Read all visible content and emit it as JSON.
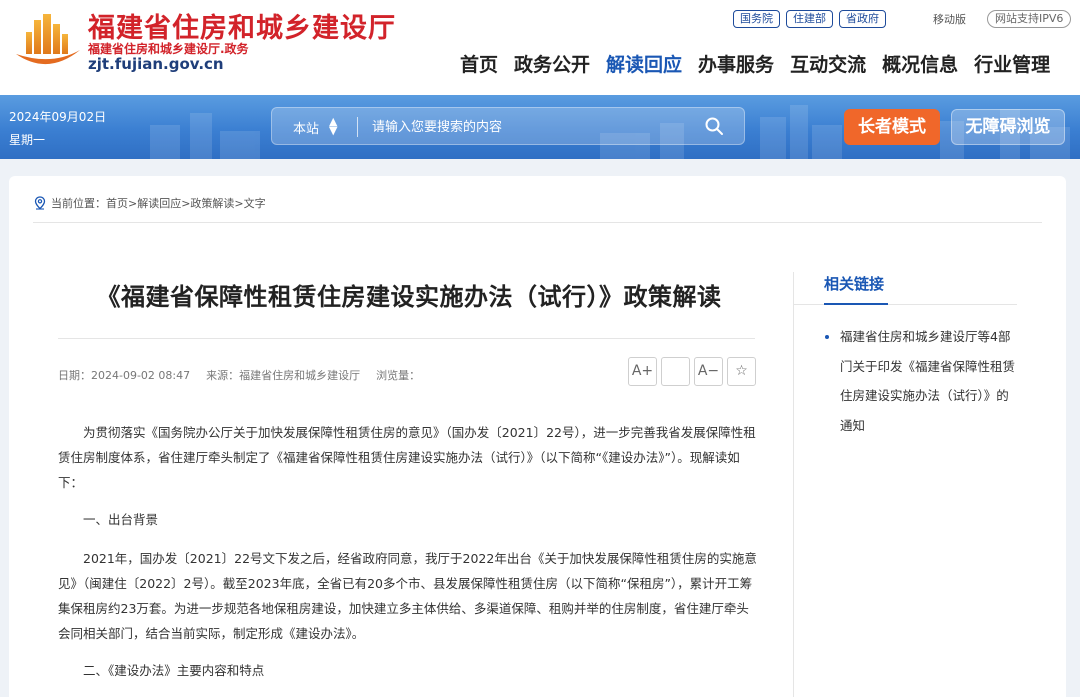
{
  "header": {
    "site_name": "福建省住房和城乡建设厅",
    "site_sub": "福建省住房和城乡建设厅.政务",
    "domain": "zjt.fujian.gov.cn",
    "top_links": [
      "国务院",
      "住建部",
      "省政府"
    ],
    "mobile": "移动版",
    "ipv6": "网站支持IPV6",
    "nav": [
      "首页",
      "政务公开",
      "解读回应",
      "办事服务",
      "互动交流",
      "概况信息",
      "行业管理"
    ],
    "active_nav": "解读回应"
  },
  "banner": {
    "date": "2024年09月02日",
    "weekday": "星期一",
    "search_scope": "本站",
    "search_placeholder": "请输入您要搜索的内容",
    "elder_mode": "长者模式",
    "accessible": "无障碍浏览"
  },
  "breadcrumb": "当前位置：首页>解读回应>政策解读>文字",
  "article": {
    "title": "《福建省保障性租赁住房建设实施办法（试行）》政策解读",
    "date": "日期：2024-09-02 08:47",
    "source": "来源：福建省住房和城乡建设厅",
    "views": "浏览量：",
    "tools": [
      "A+",
      "",
      "A−",
      "☆"
    ],
    "paragraphs": [
      "为贯彻落实《国务院办公厅关于加快发展保障性租赁住房的意见》（国办发〔2021〕22号），进一步完善我省发展保障性租赁住房制度体系，省住建厅牵头制定了《福建省保障性租赁住房建设实施办法（试行）》（以下简称“《建设办法》”）。现解读如下：",
      "一、出台背景",
      "2021年，国办发〔2021〕22号文下发之后，经省政府同意，我厅于2022年出台《关于加快发展保障性租赁住房的实施意见》（闽建住〔2022〕2号）。截至2023年底，全省已有20多个市、县发展保障性租赁住房（以下简称“保租房”），累计开工筹集保租房约23万套。为进一步规范各地保租房建设，加快建立多主体供给、多渠道保障、租购并举的住房制度，省住建厅牵头会同相关部门，结合当前实际，制定形成《建设办法》。",
      "二、《建设办法》主要内容和特点"
    ]
  },
  "related": {
    "title": "相关链接",
    "items": [
      "福建省住房和城乡建设厅等4部门关于印发《福建省保障性租赁住房建设实施办法（试行）》的通知"
    ]
  },
  "colors": {
    "brand_red": "#d2232a",
    "nav_blue": "#1a57b4",
    "banner_blue": "#3b7fd2",
    "elder_orange": "#f0672a"
  }
}
